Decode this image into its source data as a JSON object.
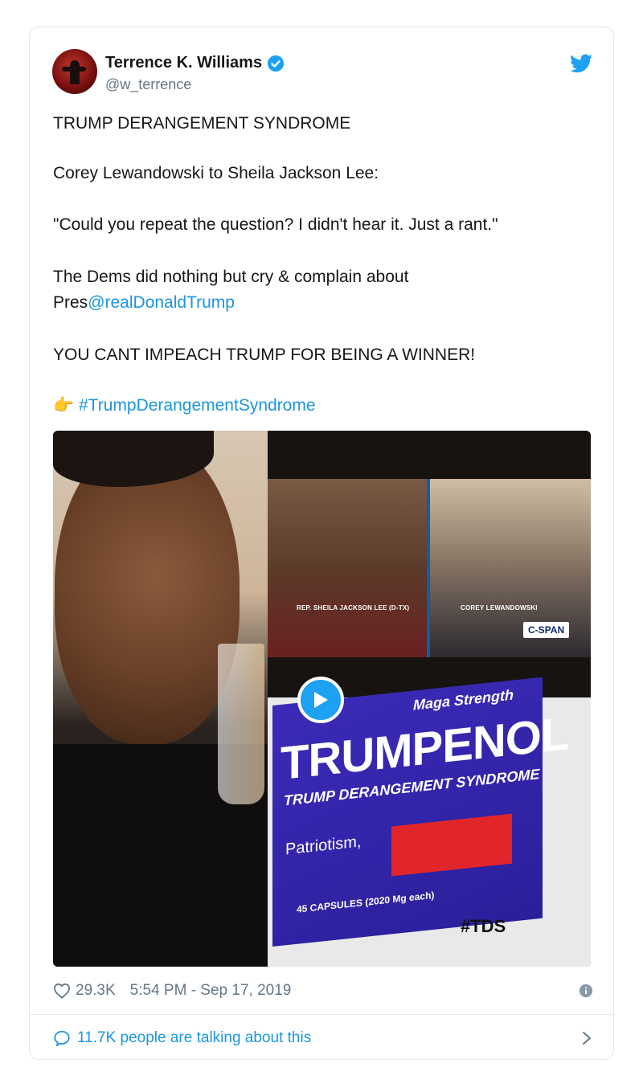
{
  "tweet": {
    "author_name": "Terrence K. Williams",
    "handle": "@w_terrence",
    "lines": {
      "l1": "TRUMP DERANGEMENT SYNDROME",
      "l2": "Corey Lewandowski to Sheila Jackson Lee:",
      "l3": "\"Could you repeat the question? I didn't hear it. Just a rant.\"",
      "l4": "The Dems did nothing but cry & complain about",
      "l5_prefix": "Pres",
      "l5_mention": "@realDonaldTrump",
      "l6": "YOU CANT IMPEACH TRUMP FOR BEING A WINNER!",
      "l7_emoji": "👉",
      "l7_hashtag": "#TrumpDerangementSyndrome"
    },
    "media": {
      "caption_left": "REP. SHEILA JACKSON LEE (D-TX)",
      "caption_right": "COREY LEWANDOWSKI",
      "network": "C-SPAN",
      "box_maga": "Maga Strength",
      "box_title": "TRUMPENOL",
      "box_subtitle": "TRUMP DERANGEMENT SYNDROME",
      "box_patriot": "Patriotism,",
      "box_caps": "45 CAPSULES (2020 Mg each)",
      "box_tag": "#TDS"
    },
    "likes": "29.3K",
    "timestamp": "5:54 PM - Sep 17, 2019",
    "talking": "11.7K people are talking about this"
  },
  "colors": {
    "link": "#1b95e0",
    "verified": "#1da1f2",
    "text": "#14171a",
    "muted": "#657786"
  }
}
